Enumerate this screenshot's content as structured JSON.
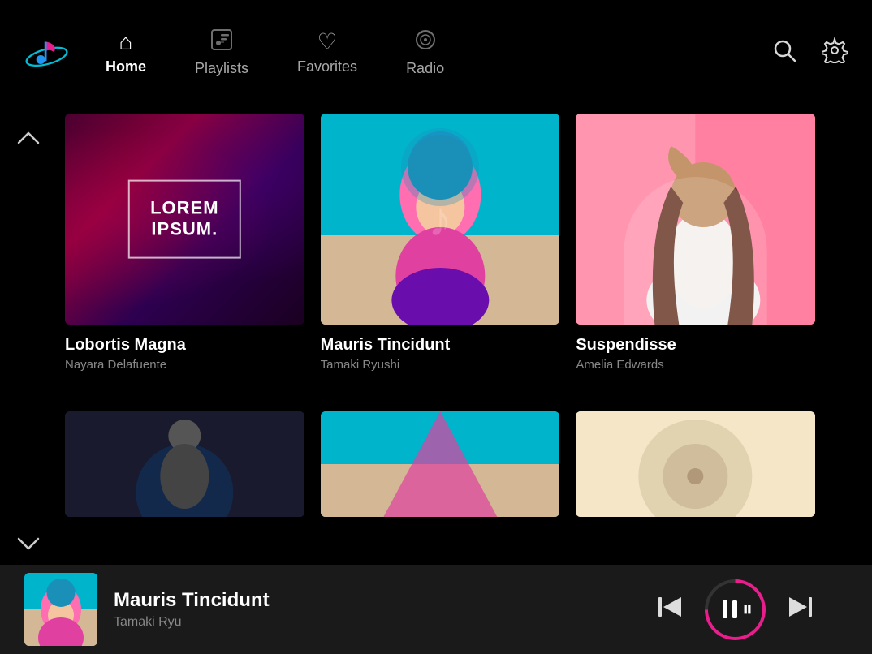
{
  "nav": {
    "items": [
      {
        "id": "home",
        "label": "Home",
        "icon": "🏠",
        "active": true
      },
      {
        "id": "playlists",
        "label": "Playlists",
        "icon": "🎵",
        "active": false
      },
      {
        "id": "favorites",
        "label": "Favorites",
        "icon": "🤍",
        "active": false
      },
      {
        "id": "radio",
        "label": "Radio",
        "icon": "📻",
        "active": false
      }
    ],
    "search_label": "Search",
    "settings_label": "Settings"
  },
  "cards": [
    {
      "id": "card-1",
      "title": "Lobortis Magna",
      "subtitle": "Nayara Delafuente",
      "album_text_line1": "LOREM",
      "album_text_line2": "IPSUM.",
      "art_type": "1"
    },
    {
      "id": "card-2",
      "title": "Mauris Tincidunt",
      "subtitle": "Tamaki Ryushi",
      "art_type": "2"
    },
    {
      "id": "card-3",
      "title": "Suspendisse",
      "subtitle": "Amelia Edwards",
      "art_type": "3"
    }
  ],
  "partial_cards": [
    {
      "id": "partial-1",
      "art_type": "4"
    },
    {
      "id": "partial-2",
      "art_type": "5"
    },
    {
      "id": "partial-3",
      "art_type": "6"
    }
  ],
  "player": {
    "title": "Mauris Tincidunt",
    "artist": "Tamaki Ryu",
    "prev_label": "Previous",
    "pause_label": "Pause",
    "next_label": "Next"
  },
  "scroll": {
    "up_label": "Scroll Up",
    "down_label": "Scroll Down"
  },
  "colors": {
    "accent": "#e91e8c",
    "bg": "#000000",
    "player_bg": "#1a1a1a",
    "text_primary": "#ffffff",
    "text_secondary": "#888888"
  }
}
